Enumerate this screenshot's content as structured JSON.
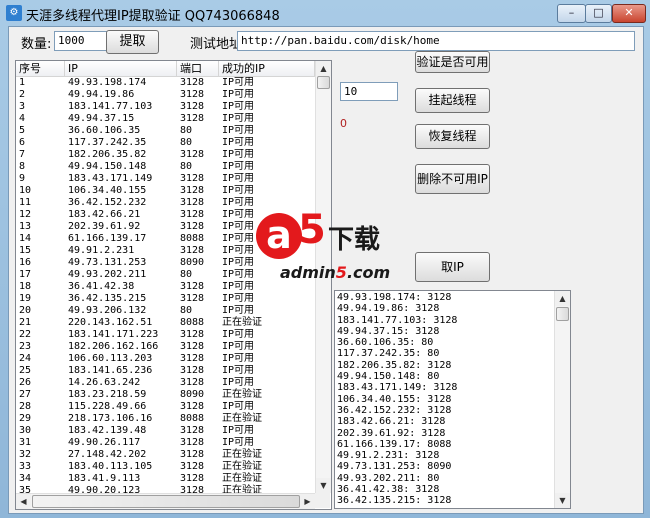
{
  "window": {
    "title": "天涯多线程代理IP提取验证 QQ743066848",
    "min": "–",
    "max": "□",
    "close": "✕"
  },
  "top": {
    "quantity_label": "数量:",
    "quantity_value": "1000",
    "extract_button": "提取",
    "test_url_label": "测试地址",
    "test_url_value": "http://pan.baidu.com/disk/home"
  },
  "table": {
    "columns": [
      "序号",
      "IP",
      "端口",
      "成功的IP"
    ],
    "rows": [
      [
        "1",
        "49.93.198.174",
        "3128",
        "IP可用"
      ],
      [
        "2",
        "49.94.19.86",
        "3128",
        "IP可用"
      ],
      [
        "3",
        "183.141.77.103",
        "3128",
        "IP可用"
      ],
      [
        "4",
        "49.94.37.15",
        "3128",
        "IP可用"
      ],
      [
        "5",
        "36.60.106.35",
        "80",
        "IP可用"
      ],
      [
        "6",
        "117.37.242.35",
        "80",
        "IP可用"
      ],
      [
        "7",
        "182.206.35.82",
        "3128",
        "IP可用"
      ],
      [
        "8",
        "49.94.150.148",
        "80",
        "IP可用"
      ],
      [
        "9",
        "183.43.171.149",
        "3128",
        "IP可用"
      ],
      [
        "10",
        "106.34.40.155",
        "3128",
        "IP可用"
      ],
      [
        "11",
        "36.42.152.232",
        "3128",
        "IP可用"
      ],
      [
        "12",
        "183.42.66.21",
        "3128",
        "IP可用"
      ],
      [
        "13",
        "202.39.61.92",
        "3128",
        "IP可用"
      ],
      [
        "14",
        "61.166.139.17",
        "8088",
        "IP可用"
      ],
      [
        "15",
        "49.91.2.231",
        "3128",
        "IP可用"
      ],
      [
        "16",
        "49.73.131.253",
        "8090",
        "IP可用"
      ],
      [
        "17",
        "49.93.202.211",
        "80",
        "IP可用"
      ],
      [
        "18",
        "36.41.42.38",
        "3128",
        "IP可用"
      ],
      [
        "19",
        "36.42.135.215",
        "3128",
        "IP可用"
      ],
      [
        "20",
        "49.93.206.132",
        "80",
        "IP可用"
      ],
      [
        "21",
        "220.143.162.51",
        "8088",
        "正在验证"
      ],
      [
        "22",
        "183.141.171.223",
        "3128",
        "IP可用"
      ],
      [
        "23",
        "182.206.162.166",
        "3128",
        "IP可用"
      ],
      [
        "24",
        "106.60.113.203",
        "3128",
        "IP可用"
      ],
      [
        "25",
        "183.141.65.236",
        "3128",
        "IP可用"
      ],
      [
        "26",
        "14.26.63.242",
        "3128",
        "IP可用"
      ],
      [
        "27",
        "183.23.218.59",
        "8090",
        "正在验证"
      ],
      [
        "28",
        "115.228.49.66",
        "3128",
        "IP可用"
      ],
      [
        "29",
        "218.173.106.16",
        "8088",
        "正在验证"
      ],
      [
        "30",
        "183.42.139.48",
        "3128",
        "IP可用"
      ],
      [
        "31",
        "49.90.26.117",
        "3128",
        "IP可用"
      ],
      [
        "32",
        "27.148.42.202",
        "3128",
        "正在验证"
      ],
      [
        "33",
        "183.40.113.105",
        "3128",
        "正在验证"
      ],
      [
        "34",
        "183.41.9.113",
        "3128",
        "正在验证"
      ],
      [
        "35",
        "49.90.20.123",
        "3128",
        "正在验证"
      ]
    ]
  },
  "right": {
    "verify_button": "验证是否可用",
    "thread_value": "10",
    "suspend_button": "挂起线程",
    "count_value": "0",
    "count_color": "#b02020",
    "resume_button": "恢复线程",
    "delete_button": "删除不可用IP",
    "fetch_button": "取IP"
  },
  "output_lines": [
    "49.93.198.174: 3128",
    "49.94.19.86: 3128",
    "183.141.77.103: 3128",
    "49.94.37.15: 3128",
    "36.60.106.35: 80",
    "117.37.242.35: 80",
    "182.206.35.82: 3128",
    "49.94.150.148: 80",
    "183.43.171.149: 3128",
    "106.34.40.155: 3128",
    "36.42.152.232: 3128",
    "183.42.66.21: 3128",
    "202.39.61.92: 3128",
    "61.166.139.17: 8088",
    "49.91.2.231: 3128",
    "49.73.131.253: 8090",
    "49.93.202.211: 80",
    "36.41.42.38: 3128",
    "36.42.135.215: 3128"
  ],
  "watermark": {
    "a": "a",
    "five": "5",
    "cn": "下载",
    "url_prefix": "admin",
    "url_num": "5",
    "url_suffix": ".com"
  }
}
